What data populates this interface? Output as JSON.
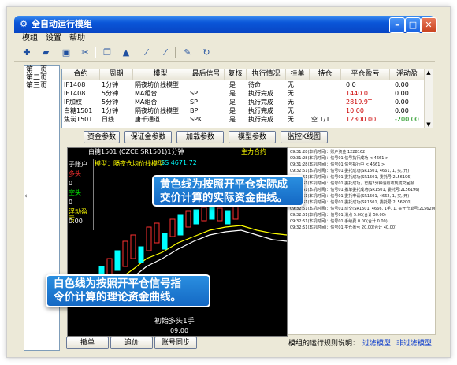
{
  "window": {
    "title": "全自动运行模组"
  },
  "menu": [
    "模组",
    "设置",
    "帮助"
  ],
  "pages": [
    "第一页",
    "第二页",
    "第三页"
  ],
  "grid": {
    "headers": [
      "合约",
      "周期",
      "模型",
      "最后信号",
      "复核",
      "执行情况",
      "挂单",
      "持仓",
      "平仓盈亏",
      "浮动盈"
    ],
    "rows": [
      {
        "contract": "IF1408",
        "period": "1分钟",
        "model": "隔夜坊价线模型",
        "signal": "",
        "review": "是",
        "status": "待命",
        "pending": "无",
        "position": "",
        "pnl": "0.0",
        "float": "0.00",
        "pnl_color": "#000000",
        "float_color": "#000000"
      },
      {
        "contract": "IF1408",
        "period": "5分钟",
        "model": "MA组合",
        "signal": "SP",
        "review": "是",
        "status": "执行完成",
        "pending": "无",
        "position": "",
        "pnl": "1440.0",
        "float": "0.00",
        "pnl_color": "#cc0000",
        "float_color": "#000000"
      },
      {
        "contract": "IF加权",
        "period": "5分钟",
        "model": "MA组合",
        "signal": "SP",
        "review": "是",
        "status": "执行完成",
        "pending": "无",
        "position": "",
        "pnl": "2819.9T",
        "float": "0.00",
        "pnl_color": "#cc0000",
        "float_color": "#000000"
      },
      {
        "contract": "白糖1501",
        "period": "1分钟",
        "model": "隔夜坊价线模型",
        "signal": "BP",
        "review": "是",
        "status": "执行完成",
        "pending": "无",
        "position": "",
        "pnl": "10.00",
        "float": "0.00",
        "pnl_color": "#cc0000",
        "float_color": "#000000"
      },
      {
        "contract": "焦炭1501",
        "period": "日线",
        "model": "唐千通道",
        "signal": "SPK",
        "review": "是",
        "status": "执行完成",
        "pending": "无",
        "position": "空 1/1",
        "pnl": "12300.00",
        "float": "-200.00",
        "pnl_color": "#cc0000",
        "float_color": "#008800"
      }
    ]
  },
  "buttons": [
    "资金参数",
    "保证金参数",
    "加载参数",
    "模型参数",
    "监控K线图"
  ],
  "chart": {
    "header_left": "白糖1501 (CZCE SR1501)1分钟",
    "header_right": "主力合约",
    "model_label": "模型：隔夜仓均价线模型",
    "ss_label": "SS 4671.72",
    "side_labels": [
      {
        "text": "子账户",
        "color": "#ffffff"
      },
      {
        "text": "多头",
        "color": "#ff3030"
      },
      {
        "text": "0",
        "color": "#ffffff"
      },
      {
        "text": "空头",
        "color": "#00ff00"
      },
      {
        "text": "0",
        "color": "#ffffff"
      },
      {
        "text": "浮动盈亏",
        "color": "#ffff00"
      },
      {
        "text": "0.00",
        "color": "#ffffff"
      }
    ],
    "xaxis_label": "09:00",
    "signal_label": "初始多头1手"
  },
  "callouts": {
    "yellow": [
      "黄色线为按照开平仓实际成",
      "交价计算的实际资金曲线。"
    ],
    "white": [
      "白色线为按照开平仓信号指",
      "令价计算的理论资金曲线。"
    ]
  },
  "log": [
    "09:31:28(本机时间)：账户资金 1228162",
    "09:31:28(本机时间)：信号01 信号执行成功 < 4661 >",
    "09:31:28(本机时间)：信号01 信号执行中 < 4661 >",
    "09:32:51(本机时间)：信号01 委托成功(SR1501, 4661, 1, 买, 开)",
    "09:32:51(本机时间)：信号01 委托成功(SR1501, 委托号:2L56196)",
    "09:32:51(本机时间)：信号01 委托成功，已超2分钟没有收到成交回报",
    "09:32:51(本机时间)：信号01 撤单委托成功(SR1501, 委托号:2L56196)",
    "09:32:51(本机时间)：信号01 委托申请(SR1501, 4662, 1, 买, 开)",
    "09:32:51(本机时间)：信号01 委托成功(SR1501, 委托号:2L56200)",
    "09:32:51(本机时间)：信号01 成交(SR1501, 4666, 1手, 1, 买开仓单号:2L56200)",
    "09:32:51(本机时间)：信号01 滑点 5.00(合计 50.00)",
    "09:32:51(本机时间)：信号01 手续费 0.00(合计 0.00)",
    "09:32:51(本机时间)：信号01 平仓盈亏 20.00(合计 40.00)"
  ],
  "bottom": {
    "buttons": [
      "撤单",
      "追价",
      "账号同步"
    ],
    "desc_label": "模组的运行规则说明：",
    "link1": "过滤模型",
    "link2": "非过滤模型"
  },
  "colors": {
    "titlebar": "#0a56d8",
    "callout": "#1a7ad4",
    "chart_bg": "#000000"
  }
}
